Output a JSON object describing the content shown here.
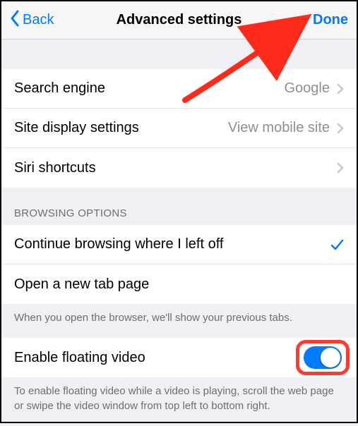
{
  "navbar": {
    "back_label": "Back",
    "title": "Advanced settings",
    "done_label": "Done"
  },
  "settings_group": [
    {
      "label": "Search engine",
      "value": "Google",
      "chevron": true
    },
    {
      "label": "Site display settings",
      "value": "View mobile site",
      "chevron": true
    },
    {
      "label": "Siri shortcuts",
      "value": "",
      "chevron": true
    }
  ],
  "browsing_options": {
    "header": "Browsing Options",
    "items": [
      {
        "label": "Continue browsing where I left off",
        "checked": true
      },
      {
        "label": "Open a new tab page",
        "checked": false
      }
    ],
    "footer": "When you open the browser, we'll show your previous tabs."
  },
  "floating_video": {
    "label": "Enable floating video",
    "enabled": true,
    "footer": "To enable floating video while a video is playing, scroll the web page or swipe the video window from top left to bottom right."
  }
}
